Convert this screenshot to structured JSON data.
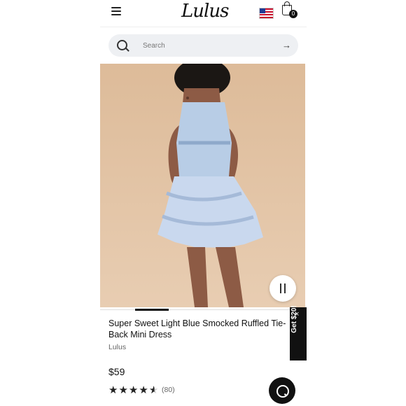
{
  "header": {
    "logo": "Lulus",
    "cart_count": "0"
  },
  "search": {
    "placeholder": "Search"
  },
  "product": {
    "title": "Super Sweet Light Blue Smocked Ruffled Tie-Back Mini Dress",
    "brand": "Lulus",
    "price": "$59",
    "rating_count": "(80)",
    "rating": 4.5
  },
  "promo": {
    "label": "Get $20!",
    "close": "×"
  },
  "colors": {
    "black": "#111111",
    "search_bg": "#eef0f3",
    "image_bg": "#dfbf9d"
  }
}
